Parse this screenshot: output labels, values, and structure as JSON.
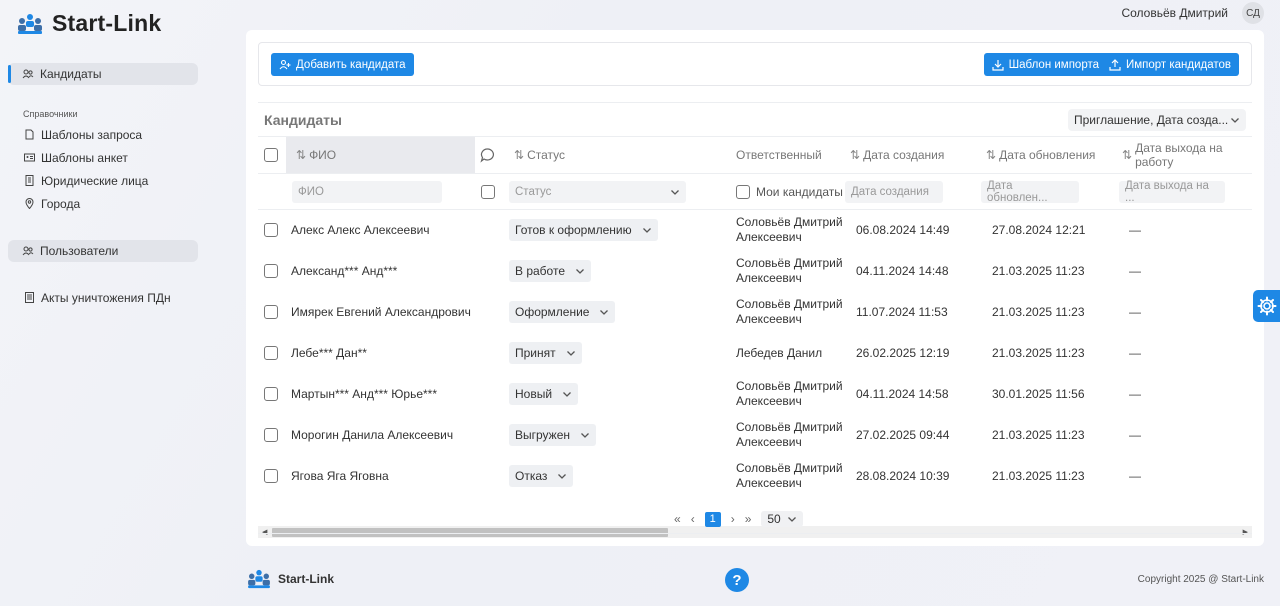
{
  "app": {
    "title": "Start-Link"
  },
  "user": {
    "name": "Соловьёв Дмитрий",
    "initials": "СД"
  },
  "sidebar": {
    "candidates": "Кандидаты",
    "section_label": "Справочники",
    "refs": [
      "Шаблоны запроса",
      "Шаблоны анкет",
      "Юридические лица",
      "Города"
    ],
    "users": "Пользователи",
    "acts": "Акты уничтожения ПДн"
  },
  "toolbar": {
    "add_label": "Добавить кандидата",
    "template_label": "Шаблон импорта",
    "import_label": "Импорт кандидатов"
  },
  "table": {
    "title": "Кандидаты",
    "sort_value": "Приглашение, Дата созда...",
    "columns": {
      "fio": "ФИО",
      "status": "Статус",
      "responsible": "Ответственный",
      "created": "Дата создания",
      "updated": "Дата обновления",
      "exit": "Дата выхода на работу"
    },
    "filters": {
      "fio": "ФИО",
      "status": "Статус",
      "my": "Мои кандидаты",
      "created": "Дата создания",
      "updated": "Дата обновлен...",
      "exit": "Дата выхода на ..."
    },
    "rows": [
      {
        "fio": "Алекс Алекс Алексеевич",
        "status": "Готов к оформлению",
        "resp1": "Соловьёв Дмитрий",
        "resp2": "Алексеевич",
        "created": "06.08.2024 14:49",
        "updated": "27.08.2024 12:21",
        "exit": "—"
      },
      {
        "fio": "Александ*** Анд***",
        "status": "В работе",
        "resp1": "Соловьёв Дмитрий",
        "resp2": "Алексеевич",
        "created": "04.11.2024 14:48",
        "updated": "21.03.2025 11:23",
        "exit": "—"
      },
      {
        "fio": "Имярек Евгений Александрович",
        "status": "Оформление",
        "resp1": "Соловьёв Дмитрий",
        "resp2": "Алексеевич",
        "created": "11.07.2024 11:53",
        "updated": "21.03.2025 11:23",
        "exit": "—"
      },
      {
        "fio": "Лебе*** Дан**",
        "status": "Принят",
        "resp1": "Лебедев Данил",
        "resp2": "",
        "created": "26.02.2025 12:19",
        "updated": "21.03.2025 11:23",
        "exit": "—"
      },
      {
        "fio": "Мартын*** Анд*** Юрье***",
        "status": "Новый",
        "resp1": "Соловьёв Дмитрий",
        "resp2": "Алексеевич",
        "created": "04.11.2024 14:58",
        "updated": "30.01.2025 11:56",
        "exit": "—"
      },
      {
        "fio": "Морогин Данила Алексеевич",
        "status": "Выгружен",
        "resp1": "Соловьёв Дмитрий",
        "resp2": "Алексеевич",
        "created": "27.02.2025 09:44",
        "updated": "21.03.2025 11:23",
        "exit": "—"
      },
      {
        "fio": "Ягова Яга Яговна",
        "status": "Отказ",
        "resp1": "Соловьёв Дмитрий",
        "resp2": "Алексеевич",
        "created": "28.08.2024 10:39",
        "updated": "21.03.2025 11:23",
        "exit": "—"
      }
    ]
  },
  "pager": {
    "first": "«",
    "prev": "‹",
    "current": "1",
    "next": "›",
    "last": "»",
    "per_page": "50"
  },
  "footer": {
    "brand": "Start-Link",
    "help": "?",
    "copyright": "Copyright 2025 @ Start-Link"
  },
  "colors": {
    "accent": "#1e88e5"
  }
}
